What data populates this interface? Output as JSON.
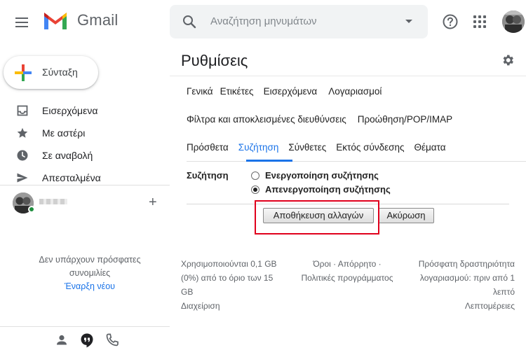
{
  "header": {
    "app_name": "Gmail",
    "search_placeholder": "Αναζήτηση μηνυμάτων"
  },
  "sidebar": {
    "compose_label": "Σύνταξη",
    "items": [
      {
        "label": "Εισερχόμενα",
        "icon": "inbox-icon"
      },
      {
        "label": "Με αστέρι",
        "icon": "star-icon"
      },
      {
        "label": "Σε αναβολή",
        "icon": "clock-icon"
      },
      {
        "label": "Απεσταλμένα",
        "icon": "send-icon"
      }
    ],
    "hangouts": {
      "no_conversations_line1": "Δεν υπάρχουν πρόσφατες",
      "no_conversations_line2": "συνομιλίες",
      "start_new": "Έναρξη νέου"
    }
  },
  "main": {
    "title": "Ρυθμίσεις",
    "tabs_row1": [
      "Γενικά",
      "Ετικέτες",
      "Εισερχόμενα",
      "Λογαριασμοί"
    ],
    "tabs_row2": [
      "Φίλτρα και αποκλεισμένες διευθύνσεις",
      "Προώθηση/POP/IMAP"
    ],
    "tabs_row3": [
      "Πρόσθετα",
      "Συζήτηση",
      "Σύνθετες",
      "Εκτός σύνδεσης",
      "Θέματα"
    ],
    "active_tab": "Συζήτηση",
    "setting": {
      "label": "Συζήτηση",
      "option_on": "Ενεργοποίηση συζήτησης",
      "option_off": "Απενεργοποίηση συζήτησης",
      "selected": "off"
    },
    "buttons": {
      "save": "Αποθήκευση αλλαγών",
      "cancel": "Ακύρωση"
    },
    "footer": {
      "storage_line1": "Χρησιμοποιούνται 0,1 GB",
      "storage_line2": "(0%) από το όριο των 15",
      "storage_line3": "GB",
      "manage": "Διαχείριση",
      "terms_line1": "Όροι · Απόρρητο ·",
      "terms_line2": "Πολιτικές προγράμματος",
      "activity_line1": "Πρόσφατη δραστηριότητα",
      "activity_line2": "λογαριασμού: πριν από 1",
      "activity_line3": "λεπτό",
      "details": "Λεπτομέρειες"
    }
  },
  "colors": {
    "accent_blue": "#1a73e8",
    "highlight_red": "#e0001c",
    "online_green": "#1e8e3e"
  }
}
